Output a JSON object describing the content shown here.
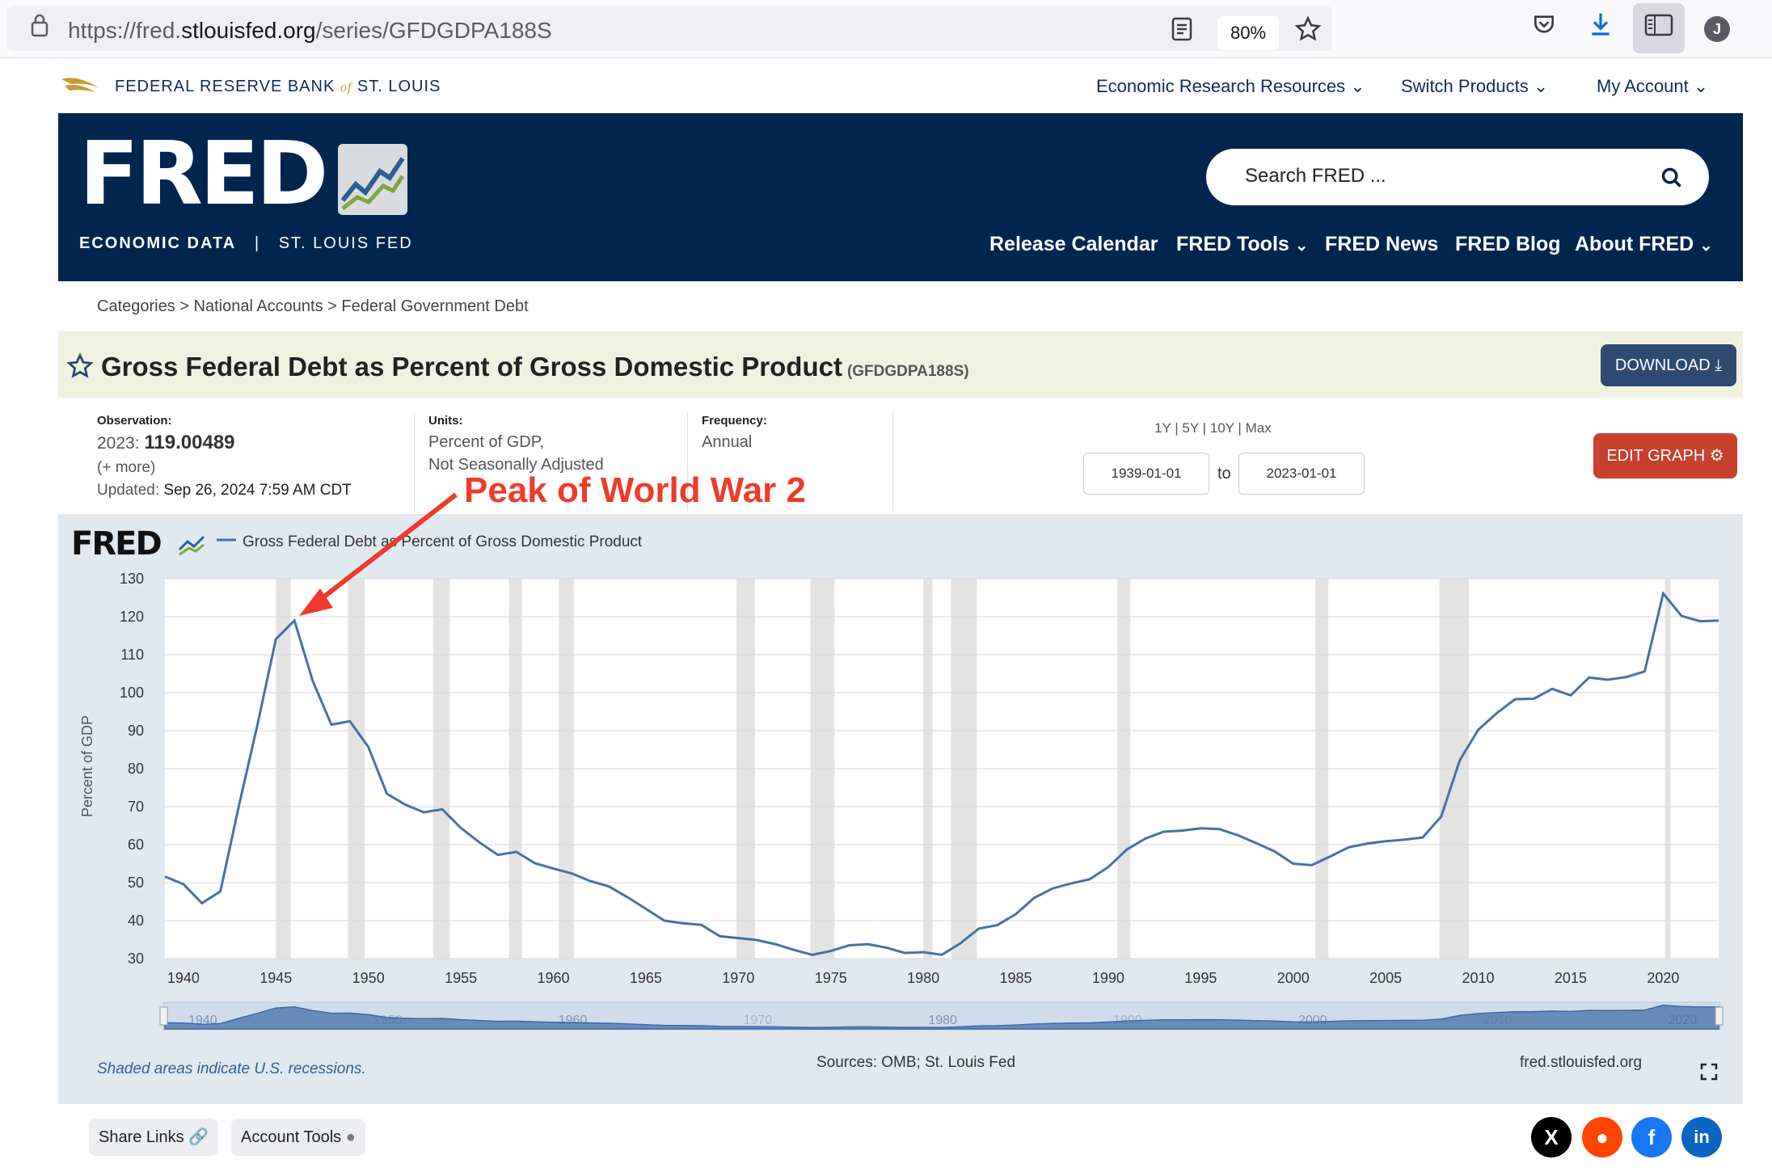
{
  "browser": {
    "url_prefix": "https://fred.",
    "url_domain": "stlouisfed.org",
    "url_path": "/series/GFDGDPA188S",
    "zoom": "80%",
    "profile_initial": "J"
  },
  "topnav": {
    "bank_name": "FEDERAL RESERVE BANK",
    "bank_of": "of",
    "bank_city": "ST. LOUIS",
    "links": [
      "Economic Research Resources",
      "Switch Products",
      "My Account"
    ]
  },
  "banner": {
    "logo": "FRED",
    "subtitle_left": "ECONOMIC DATA",
    "subtitle_sep": "|",
    "subtitle_right": "ST. LOUIS FED",
    "search_placeholder": "Search FRED ...",
    "nav": [
      "Release Calendar",
      "FRED Tools",
      "FRED News",
      "FRED Blog",
      "About FRED"
    ]
  },
  "breadcrumb": "Categories > National Accounts > Federal Government Debt",
  "series": {
    "title": "Gross Federal Debt as Percent of Gross Domestic Product",
    "code": "(GFDGDPA188S)",
    "download_label": "DOWNLOAD",
    "edit_label": "EDIT GRAPH"
  },
  "meta": {
    "observation_label": "Observation:",
    "observation_date": "2023:",
    "observation_value": "119.00489",
    "more": "(+ more)",
    "updated_label": "Updated:",
    "updated_value": "Sep 26, 2024 7:59 AM CDT",
    "units_label": "Units:",
    "units_line1": "Percent of GDP,",
    "units_line2": "Not Seasonally Adjusted",
    "frequency_label": "Frequency:",
    "frequency_value": "Annual",
    "ranges": [
      "1Y",
      "5Y",
      "10Y",
      "Max"
    ],
    "date_from": "1939-01-01",
    "date_to_label": "to",
    "date_to": "2023-01-01"
  },
  "annotation": "Peak of World War 2",
  "chart_footer": {
    "recession_note": "Shaded areas indicate U.S. recessions.",
    "sources": "Sources: OMB; St. Louis Fed",
    "site": "fred.stlouisfed.org"
  },
  "footer": {
    "share_links": "Share Links",
    "account_tools": "Account Tools"
  },
  "colors": {
    "navy": "#00254f",
    "line": "#4572a7",
    "download_btn": "#2d4a73",
    "edit_btn": "#c8402e",
    "annotation": "#ee3b2b"
  },
  "chart_data": {
    "type": "line",
    "legend": "Gross Federal Debt as Percent of Gross Domestic Product",
    "ylabel": "Percent of GDP",
    "xlabel": "",
    "ylim": [
      30,
      130
    ],
    "yticks": [
      30,
      40,
      50,
      60,
      70,
      80,
      90,
      100,
      110,
      120,
      130
    ],
    "xlim": [
      1939,
      2023
    ],
    "xticks": [
      1940,
      1945,
      1950,
      1955,
      1960,
      1965,
      1970,
      1975,
      1980,
      1985,
      1990,
      1995,
      2000,
      2005,
      2010,
      2015,
      2020
    ],
    "navigator_ticks": [
      1940,
      1960,
      1980,
      2000,
      2020
    ],
    "navigator_faint_ticks": [
      1950,
      1970,
      1990,
      2010
    ],
    "recessions": [
      [
        1945,
        1945.8
      ],
      [
        1948.9,
        1949.8
      ],
      [
        1953.5,
        1954.4
      ],
      [
        1957.6,
        1958.3
      ],
      [
        1960.3,
        1961.1
      ],
      [
        1969.9,
        1970.9
      ],
      [
        1973.9,
        1975.2
      ],
      [
        1980,
        1980.5
      ],
      [
        1981.5,
        1982.9
      ],
      [
        1990.5,
        1991.2
      ],
      [
        2001.2,
        2001.9
      ],
      [
        2007.9,
        2009.5
      ],
      [
        2020.1,
        2020.4
      ]
    ],
    "x": [
      1939,
      1940,
      1941,
      1942,
      1943,
      1944,
      1945,
      1946,
      1947,
      1948,
      1949,
      1950,
      1951,
      1952,
      1953,
      1954,
      1955,
      1956,
      1957,
      1958,
      1959,
      1960,
      1961,
      1962,
      1963,
      1964,
      1965,
      1966,
      1967,
      1968,
      1969,
      1970,
      1971,
      1972,
      1973,
      1974,
      1975,
      1976,
      1977,
      1978,
      1979,
      1980,
      1981,
      1982,
      1983,
      1984,
      1985,
      1986,
      1987,
      1988,
      1989,
      1990,
      1991,
      1992,
      1993,
      1994,
      1995,
      1996,
      1997,
      1998,
      1999,
      2000,
      2001,
      2002,
      2003,
      2004,
      2005,
      2006,
      2007,
      2008,
      2009,
      2010,
      2011,
      2012,
      2013,
      2014,
      2015,
      2016,
      2017,
      2018,
      2019,
      2020,
      2021,
      2022,
      2023
    ],
    "y": [
      51.6,
      49.6,
      44.6,
      47.7,
      70.2,
      91.5,
      114.1,
      119.0,
      103.0,
      91.6,
      92.5,
      85.7,
      73.4,
      70.5,
      68.5,
      69.3,
      64.4,
      60.6,
      57.3,
      58.1,
      55.1,
      53.7,
      52.4,
      50.4,
      49.0,
      46.2,
      43.1,
      40.0,
      39.3,
      38.9,
      35.9,
      35.4,
      34.9,
      33.8,
      32.3,
      31.0,
      32.0,
      33.5,
      33.8,
      32.9,
      31.5,
      31.7,
      31.0,
      34.0,
      37.9,
      38.8,
      41.7,
      46.0,
      48.5,
      49.8,
      50.9,
      54.1,
      58.7,
      61.6,
      63.4,
      63.7,
      64.3,
      64.1,
      62.5,
      60.4,
      58.2,
      55.0,
      54.6,
      56.9,
      59.3,
      60.3,
      60.9,
      61.3,
      61.9,
      67.4,
      82.2,
      90.2,
      94.6,
      98.3,
      98.4,
      101.0,
      99.3,
      104.0,
      103.4,
      104.1,
      105.6,
      126.1,
      120.2,
      118.8,
      119.0
    ]
  }
}
